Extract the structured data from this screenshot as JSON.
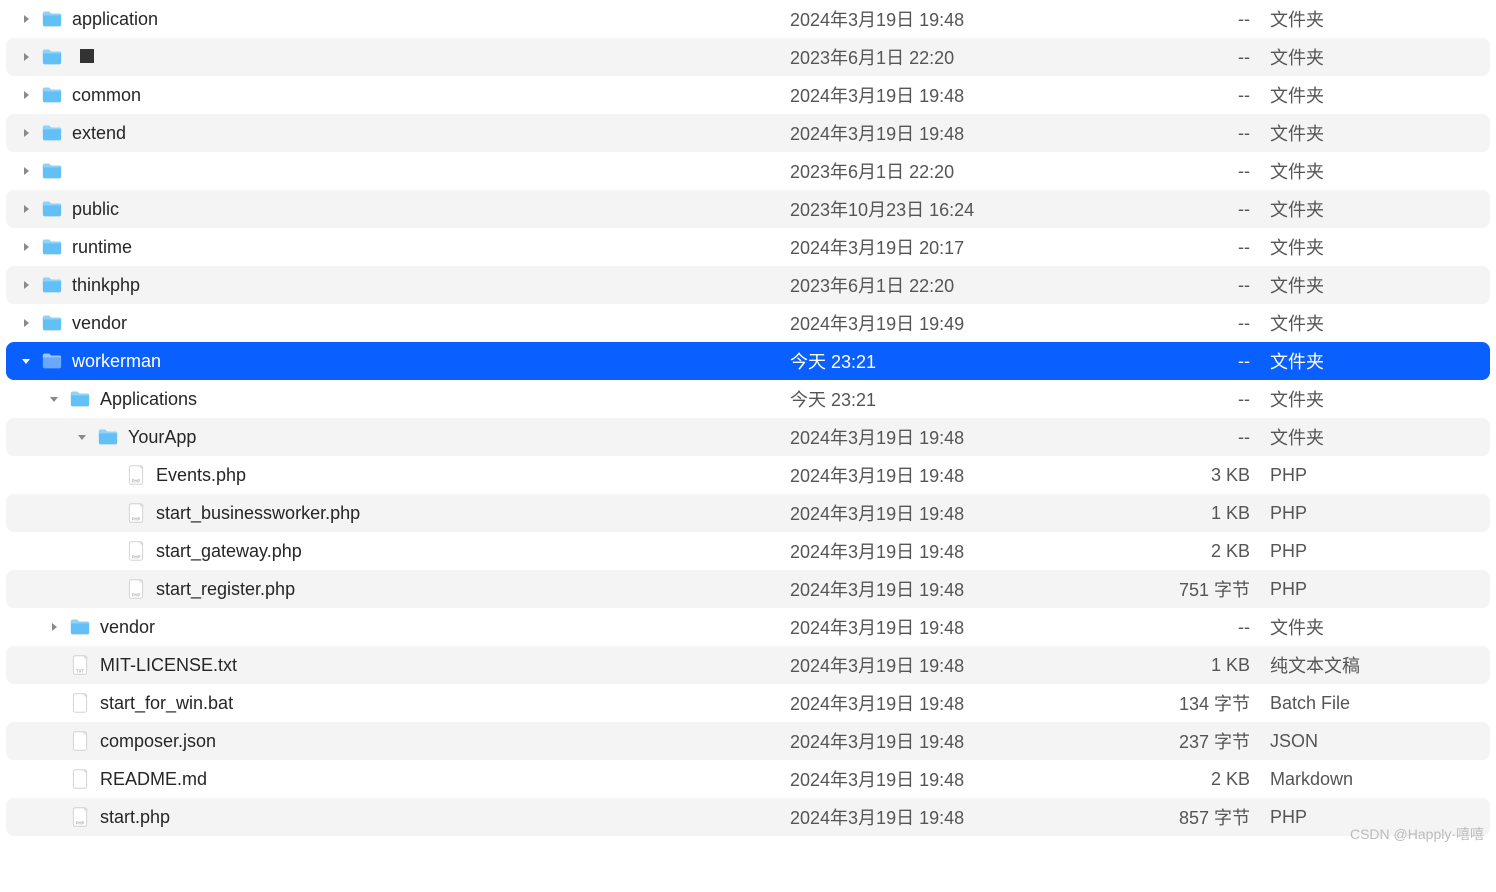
{
  "watermark": "CSDN @Happly·嘻嘻",
  "rows": [
    {
      "indent": 0,
      "disclose": "right",
      "icon": "folder",
      "name": "application",
      "date": "2024年3月19日 19:48",
      "size": "--",
      "kind": "文件夹",
      "selected": false
    },
    {
      "indent": 0,
      "disclose": "right",
      "icon": "folder",
      "name": "",
      "extra": "pixel",
      "date": "2023年6月1日 22:20",
      "size": "--",
      "kind": "文件夹",
      "selected": false
    },
    {
      "indent": 0,
      "disclose": "right",
      "icon": "folder",
      "name": "common",
      "date": "2024年3月19日 19:48",
      "size": "--",
      "kind": "文件夹",
      "selected": false
    },
    {
      "indent": 0,
      "disclose": "right",
      "icon": "folder",
      "name": "extend",
      "date": "2024年3月19日 19:48",
      "size": "--",
      "kind": "文件夹",
      "selected": false
    },
    {
      "indent": 0,
      "disclose": "right",
      "icon": "folder",
      "name": "",
      "date": "2023年6月1日 22:20",
      "size": "--",
      "kind": "文件夹",
      "selected": false
    },
    {
      "indent": 0,
      "disclose": "right",
      "icon": "folder",
      "name": "public",
      "date": "2023年10月23日 16:24",
      "size": "--",
      "kind": "文件夹",
      "selected": false
    },
    {
      "indent": 0,
      "disclose": "right",
      "icon": "folder",
      "name": "runtime",
      "date": "2024年3月19日 20:17",
      "size": "--",
      "kind": "文件夹",
      "selected": false
    },
    {
      "indent": 0,
      "disclose": "right",
      "icon": "folder",
      "name": "thinkphp",
      "date": "2023年6月1日 22:20",
      "size": "--",
      "kind": "文件夹",
      "selected": false
    },
    {
      "indent": 0,
      "disclose": "right",
      "icon": "folder",
      "name": "vendor",
      "date": "2024年3月19日 19:49",
      "size": "--",
      "kind": "文件夹",
      "selected": false
    },
    {
      "indent": 0,
      "disclose": "down",
      "icon": "folder-sel",
      "name": "workerman",
      "date": "今天 23:21",
      "size": "--",
      "kind": "文件夹",
      "selected": true
    },
    {
      "indent": 1,
      "disclose": "down",
      "icon": "folder",
      "name": "Applications",
      "date": "今天 23:21",
      "size": "--",
      "kind": "文件夹",
      "selected": false
    },
    {
      "indent": 2,
      "disclose": "down",
      "icon": "folder",
      "name": "YourApp",
      "date": "2024年3月19日 19:48",
      "size": "--",
      "kind": "文件夹",
      "selected": false
    },
    {
      "indent": 3,
      "disclose": "none",
      "icon": "php",
      "name": "Events.php",
      "date": "2024年3月19日 19:48",
      "size": "3 KB",
      "kind": "PHP",
      "selected": false
    },
    {
      "indent": 3,
      "disclose": "none",
      "icon": "php",
      "name": "start_businessworker.php",
      "date": "2024年3月19日 19:48",
      "size": "1 KB",
      "kind": "PHP",
      "selected": false
    },
    {
      "indent": 3,
      "disclose": "none",
      "icon": "php",
      "name": "start_gateway.php",
      "date": "2024年3月19日 19:48",
      "size": "2 KB",
      "kind": "PHP",
      "selected": false
    },
    {
      "indent": 3,
      "disclose": "none",
      "icon": "php",
      "name": "start_register.php",
      "date": "2024年3月19日 19:48",
      "size": "751 字节",
      "kind": "PHP",
      "selected": false
    },
    {
      "indent": 1,
      "disclose": "right",
      "icon": "folder",
      "name": "vendor",
      "date": "2024年3月19日 19:48",
      "size": "--",
      "kind": "文件夹",
      "selected": false
    },
    {
      "indent": 1,
      "disclose": "none",
      "icon": "txt",
      "name": "MIT-LICENSE.txt",
      "date": "2024年3月19日 19:48",
      "size": "1 KB",
      "kind": "纯文本文稿",
      "selected": false
    },
    {
      "indent": 1,
      "disclose": "none",
      "icon": "blank",
      "name": "start_for_win.bat",
      "date": "2024年3月19日 19:48",
      "size": "134 字节",
      "kind": "Batch File",
      "selected": false
    },
    {
      "indent": 1,
      "disclose": "none",
      "icon": "blank",
      "name": "composer.json",
      "date": "2024年3月19日 19:48",
      "size": "237 字节",
      "kind": "JSON",
      "selected": false
    },
    {
      "indent": 1,
      "disclose": "none",
      "icon": "blank",
      "name": "README.md",
      "date": "2024年3月19日 19:48",
      "size": "2 KB",
      "kind": "Markdown",
      "selected": false
    },
    {
      "indent": 1,
      "disclose": "none",
      "icon": "php",
      "name": "start.php",
      "date": "2024年3月19日 19:48",
      "size": "857 字节",
      "kind": "PHP",
      "selected": false
    }
  ]
}
